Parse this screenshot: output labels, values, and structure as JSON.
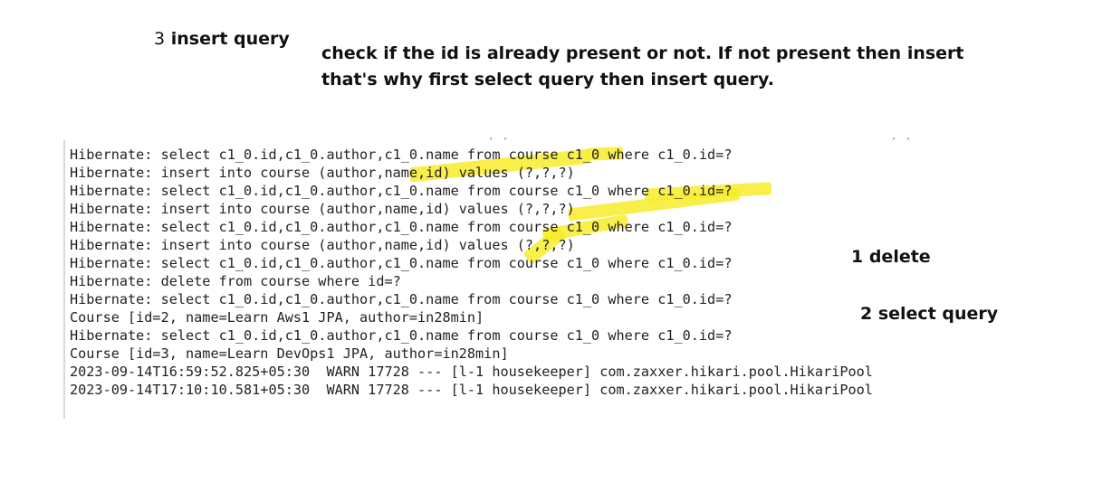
{
  "annotations": {
    "insert_query_number": "3",
    "insert_query_text": "insert query",
    "note_line1": "check if the id is already present or not. If not  present then insert",
    "note_line2": "that's why first select query then insert query.",
    "delete_label": "1 delete",
    "select_query_label": "2 select query"
  },
  "console": {
    "stray_top": "' '",
    "stray_right": "' '",
    "lines": [
      "Hibernate: select c1_0.id,c1_0.author,c1_0.name from course c1_0 where c1_0.id=?",
      "Hibernate: insert into course (author,name,id) values (?,?,?)",
      "Hibernate: select c1_0.id,c1_0.author,c1_0.name from course c1_0 where c1_0.id=?",
      "Hibernate: insert into course (author,name,id) values (?,?,?)",
      "Hibernate: select c1_0.id,c1_0.author,c1_0.name from course c1_0 where c1_0.id=?",
      "Hibernate: insert into course (author,name,id) values (?,?,?)",
      "Hibernate: select c1_0.id,c1_0.author,c1_0.name from course c1_0 where c1_0.id=?",
      "Hibernate: delete from course where id=?",
      "Hibernate: select c1_0.id,c1_0.author,c1_0.name from course c1_0 where c1_0.id=?",
      "Course [id=2, name=Learn Aws1 JPA, author=in28min]",
      "Hibernate: select c1_0.id,c1_0.author,c1_0.name from course c1_0 where c1_0.id=?",
      "Course [id=3, name=Learn DevOps1 JPA, author=in28min]",
      "2023-09-14T16:59:52.825+05:30  WARN 17728 --- [l-1 housekeeper] com.zaxxer.hikari.pool.HikariPool",
      "2023-09-14T17:10:10.581+05:30  WARN 17728 --- [l-1 housekeeper] com.zaxxer.hikari.pool.HikariPool"
    ]
  },
  "colors": {
    "highlight": "#f7ec2a",
    "text": "#222222"
  }
}
